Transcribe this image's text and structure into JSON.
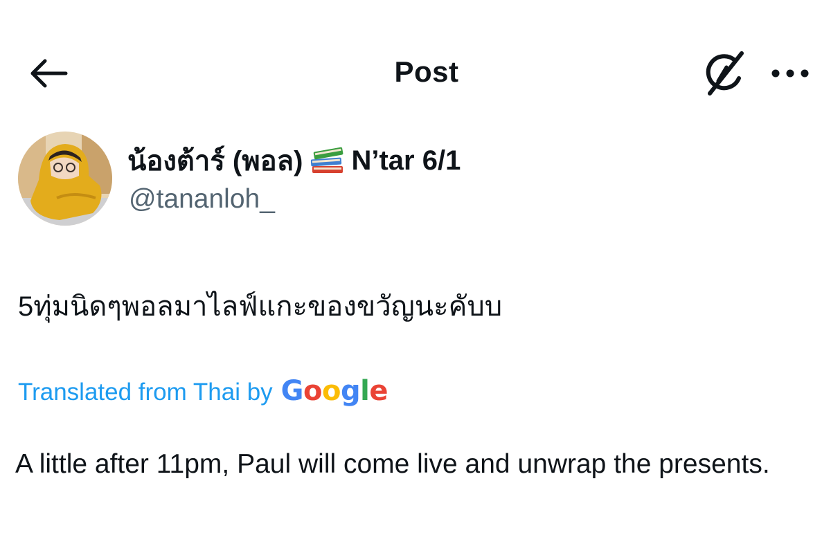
{
  "header": {
    "title": "Post",
    "back_icon": "arrow-left-icon",
    "grok_icon": "grok-icon",
    "more_icon": "more-horizontal-icon"
  },
  "author": {
    "display_name": "น้องต้าร์ (พอล)",
    "badge_icon": "books-emoji-icon",
    "display_name_suffix": "N’tar 6/1",
    "handle": "@tananloh_"
  },
  "post": {
    "text": "5ทุ่มนิดๆพอลมาไลฟ์แกะของขวัญนะคับบ",
    "translation_label": "Translated from Thai by",
    "translation_provider": "Google",
    "translation": "A little after 11pm, Paul will come live and unwrap the presents."
  },
  "colors": {
    "text": "#0f1419",
    "secondary": "#536471",
    "link": "#1d9bf0",
    "google_blue": "#4285F4",
    "google_red": "#EA4335",
    "google_yellow": "#FBBC05",
    "google_green": "#34A853"
  }
}
